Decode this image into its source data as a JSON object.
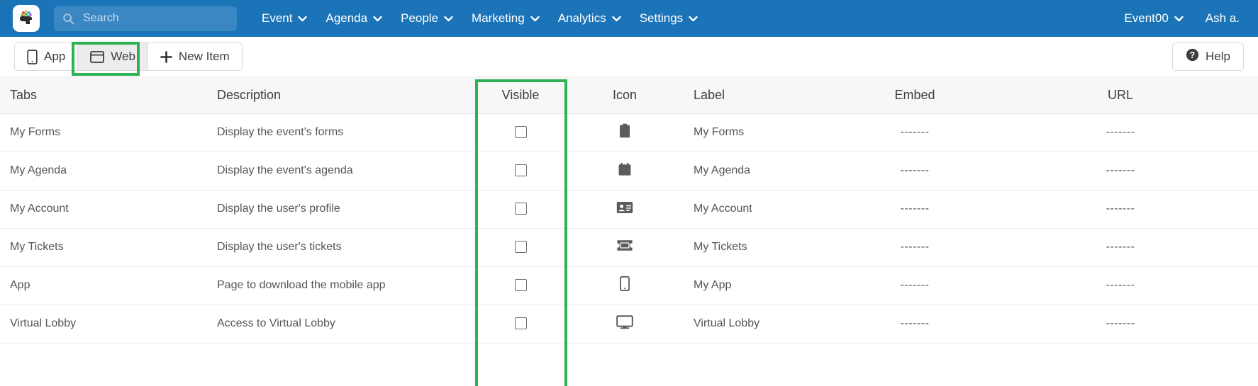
{
  "theme": {
    "header_bg": "#1b74b8",
    "search_bg": "#3a87c4",
    "annotation_green": "#2eb153",
    "table_head_bg": "#f7f7f7"
  },
  "header": {
    "logo_icon": "brand-logo-icon",
    "search": {
      "placeholder": "Search",
      "value": "",
      "icon": "search-icon"
    },
    "nav": [
      {
        "label": "Event",
        "icon": "chevron-down-icon"
      },
      {
        "label": "Agenda",
        "icon": "chevron-down-icon"
      },
      {
        "label": "People",
        "icon": "chevron-down-icon"
      },
      {
        "label": "Marketing",
        "icon": "chevron-down-icon"
      },
      {
        "label": "Analytics",
        "icon": "chevron-down-icon"
      },
      {
        "label": "Settings",
        "icon": "chevron-down-icon"
      }
    ],
    "event_selector": {
      "label": "Event00",
      "icon": "chevron-down-icon"
    },
    "user": {
      "label": "Ash a."
    }
  },
  "toolbar": {
    "view_buttons": [
      {
        "label": "App",
        "icon": "mobile-icon",
        "active": false
      },
      {
        "label": "Web",
        "icon": "browser-window-icon",
        "active": true
      }
    ],
    "new_item": {
      "label": "New Item",
      "icon": "plus-icon"
    },
    "help": {
      "label": "Help",
      "icon": "question-circle-icon"
    }
  },
  "table": {
    "columns": [
      {
        "key": "tabs",
        "label": "Tabs"
      },
      {
        "key": "description",
        "label": "Description"
      },
      {
        "key": "visible",
        "label": "Visible"
      },
      {
        "key": "icon",
        "label": "Icon"
      },
      {
        "key": "label",
        "label": "Label"
      },
      {
        "key": "embed",
        "label": "Embed"
      },
      {
        "key": "url",
        "label": "URL"
      }
    ],
    "rows": [
      {
        "tabs": "My Forms",
        "description": "Display the event's forms",
        "visible": false,
        "icon": "clipboard-icon",
        "label": "My Forms",
        "embed": "-------",
        "url": "-------"
      },
      {
        "tabs": "My Agenda",
        "description": "Display the event's agenda",
        "visible": false,
        "icon": "calendar-icon",
        "label": "My Agenda",
        "embed": "-------",
        "url": "-------"
      },
      {
        "tabs": "My Account",
        "description": "Display the user's profile",
        "visible": false,
        "icon": "id-card-icon",
        "label": "My Account",
        "embed": "-------",
        "url": "-------"
      },
      {
        "tabs": "My Tickets",
        "description": "Display the user's tickets",
        "visible": false,
        "icon": "ticket-icon",
        "label": "My Tickets",
        "embed": "-------",
        "url": "-------"
      },
      {
        "tabs": "App",
        "description": "Page to download the mobile app",
        "visible": false,
        "icon": "mobile-icon",
        "label": "My App",
        "embed": "-------",
        "url": "-------"
      },
      {
        "tabs": "Virtual Lobby",
        "description": "Access to Virtual Lobby",
        "visible": false,
        "icon": "desktop-monitor-icon",
        "label": "Virtual Lobby",
        "embed": "-------",
        "url": "-------"
      }
    ]
  },
  "annotations": [
    {
      "name": "highlight-web-button",
      "target": "Web"
    },
    {
      "name": "highlight-visible-column",
      "target": "Visible"
    }
  ]
}
